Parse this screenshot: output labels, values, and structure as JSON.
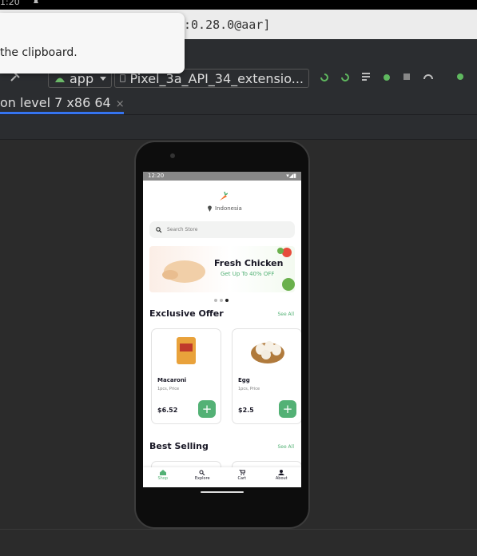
{
  "system": {
    "time": "1:20"
  },
  "window": {
    "title": ":0.28.0@aar]"
  },
  "notification": {
    "message": "the clipboard."
  },
  "toolbar": {
    "module": "app",
    "device": "Pixel_3a_API_34_extensio..."
  },
  "emulator_tab": {
    "label": "on level 7 x86 64",
    "close": "×"
  },
  "phone": {
    "status_time": "12:20",
    "location": "Indonesia",
    "search_placeholder": "Search Store",
    "banner": {
      "title": "Fresh Chicken",
      "subtitle": "Get Up To 40% OFF"
    },
    "exclusive": {
      "title": "Exclusive Offer",
      "see_all": "See All",
      "products": [
        {
          "name": "Macaroni",
          "qty": "1pcs, Price",
          "price": "$6.52"
        },
        {
          "name": "Egg",
          "qty": "1pcs, Price",
          "price": "$2.5"
        }
      ]
    },
    "best_selling": {
      "title": "Best Selling",
      "see_all": "See All"
    },
    "nav": [
      {
        "label": "Shop",
        "icon": "home-icon"
      },
      {
        "label": "Explore",
        "icon": "search-icon"
      },
      {
        "label": "Cart",
        "icon": "cart-icon"
      },
      {
        "label": "About",
        "icon": "person-icon"
      }
    ],
    "accent": "#53B175"
  }
}
